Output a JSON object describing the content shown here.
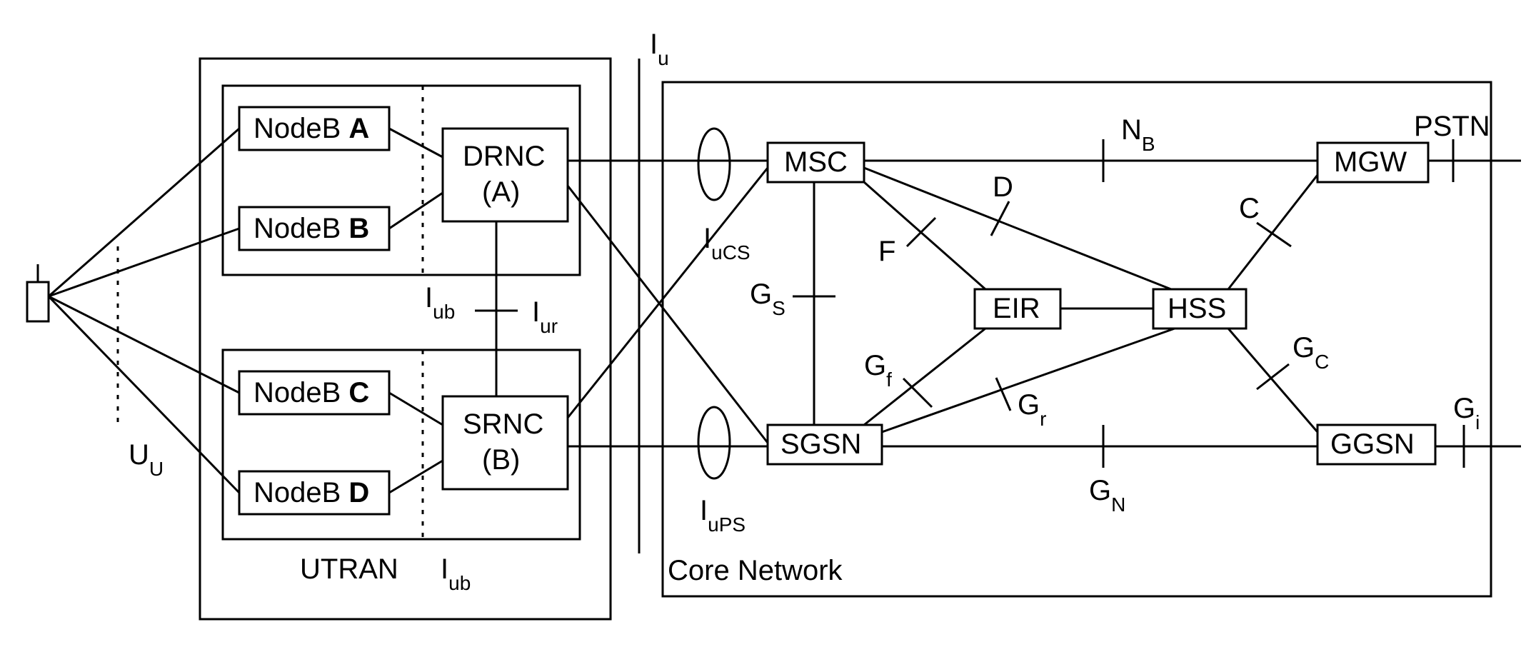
{
  "ue": {
    "label": ""
  },
  "interfaces": {
    "Uu": "U",
    "Uu_sub": "U",
    "Iub_top": "I",
    "Iub_top_sub": "ub",
    "Iur": "I",
    "Iur_sub": "ur",
    "Iub_bottom": "I",
    "Iub_bottom_sub": "ub",
    "Iu": "I",
    "Iu_sub": "u",
    "IuCS": "I",
    "IuCS_sub": "uCS",
    "IuPS": "I",
    "IuPS_sub": "uPS",
    "Gs": "G",
    "Gs_sub": "S",
    "Gf": "G",
    "Gf_sub": "f",
    "Gr": "G",
    "Gr_sub": "r",
    "Gn": "G",
    "Gn_sub": "N",
    "Gc": "G",
    "Gc_sub": "C",
    "Gi": "G",
    "Gi_sub": "i",
    "F": "F",
    "D": "D",
    "C": "C",
    "Nb": "N",
    "Nb_sub": "B",
    "PSTN": "PSTN"
  },
  "utran": {
    "label": "UTRAN",
    "rns_a": {
      "nodeb_a_prefix": "NodeB ",
      "nodeb_a_id": "A",
      "nodeb_b_prefix": "NodeB ",
      "nodeb_b_id": "B",
      "rnc_line1": "DRNC",
      "rnc_line2": "(A)"
    },
    "rns_b": {
      "nodeb_c_prefix": "NodeB ",
      "nodeb_c_id": "C",
      "nodeb_d_prefix": "NodeB ",
      "nodeb_d_id": "D",
      "rnc_line1": "SRNC",
      "rnc_line2": "(B)"
    }
  },
  "core": {
    "label": "Core Network",
    "msc": "MSC",
    "sgsn": "SGSN",
    "eir": "EIR",
    "hss": "HSS",
    "mgw": "MGW",
    "ggsn": "GGSN"
  }
}
